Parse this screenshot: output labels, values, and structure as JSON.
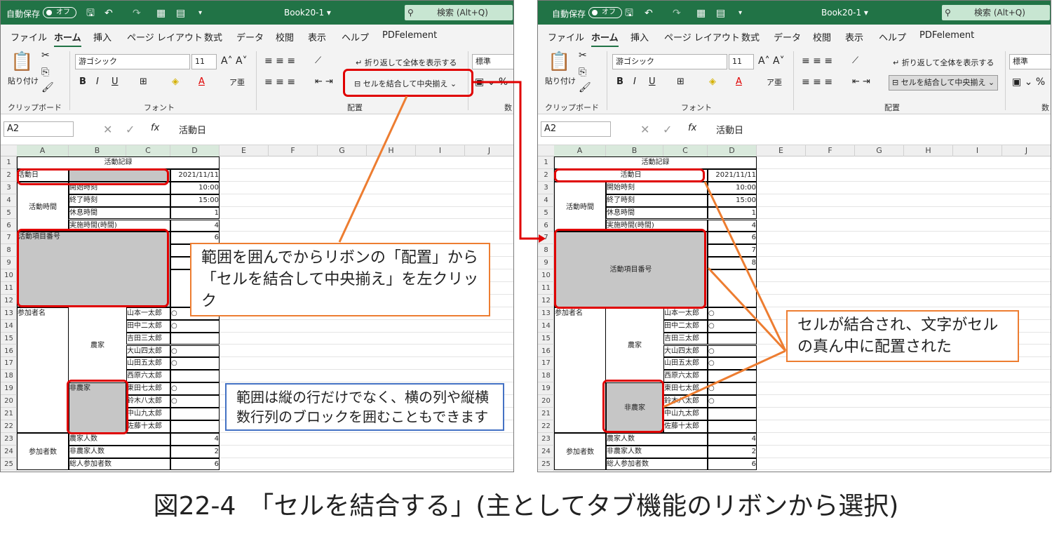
{
  "caption": "図22-4　「セルを結合する」(主としてタブ機能のリボンから選択)",
  "titlebar": {
    "autosave": "自動保存",
    "autosave_state": "オフ",
    "book": "Book20-1 ▾",
    "search": "検索 (Alt+Q)"
  },
  "menu": [
    "ファイル",
    "ホーム",
    "挿入",
    "ページ レイアウト",
    "数式",
    "データ",
    "校閲",
    "表示",
    "ヘルプ",
    "PDFelement"
  ],
  "ribbon": {
    "paste": "貼り付け",
    "clipboard_group": "クリップボード",
    "font_name": "游ゴシック",
    "font_size": "11",
    "font_group": "フォント",
    "wrap_text": "折り返して全体を表示する",
    "merge_center": "セルを結合して中央揃え",
    "align_group": "配置",
    "number_format": "標準",
    "number_group": "数",
    "bold": "B",
    "italic": "I",
    "underline": "U"
  },
  "formula": {
    "namebox": "A2",
    "fx": "fx",
    "content": "活動日"
  },
  "columns": [
    "A",
    "B",
    "C",
    "D",
    "E",
    "F",
    "G",
    "H",
    "I",
    "J"
  ],
  "rows": [
    "1",
    "2",
    "3",
    "4",
    "5",
    "6",
    "7",
    "8",
    "9",
    "10",
    "11",
    "12",
    "13",
    "14",
    "15",
    "16",
    "17",
    "18",
    "19",
    "20",
    "21",
    "22",
    "23",
    "24",
    "25"
  ],
  "cells": {
    "title": "活動記録",
    "date_label": "活動日",
    "date_value": "2021/11/11",
    "start": "開始時刻",
    "end": "終了時刻",
    "rest": "休息時間",
    "actual": "実施時間(時間)",
    "activity_time": "活動時間",
    "item_no": "活動項目番号",
    "participants": "参加者名",
    "farmer": "農家",
    "nonfarmer": "非農家",
    "people": [
      "山本一太郎",
      "田中二太郎",
      "吉田三太郎",
      "大山四太郎",
      "山田五太郎",
      "西原六太郎",
      "東田七太郎",
      "鈴木八太郎",
      "中山九太郎",
      "佐藤十太郎"
    ],
    "marks": [
      "○",
      "○",
      "",
      "○",
      "○",
      "",
      "○",
      "○",
      "",
      ""
    ],
    "farmer_count": "農家人数",
    "nonfarmer_count": "非農家人数",
    "total": "総人参加者数",
    "participant_count": "参加者数",
    "values": {
      "start": "10:00",
      "end": "15:00",
      "rest": "1",
      "actual": "4",
      "r7": "6",
      "r8": "7",
      "r9": "8",
      "farmer_n": "4",
      "nonfarmer_n": "2",
      "total_n": "6"
    }
  },
  "callouts": {
    "left_orange": "範囲を囲んでからリボンの「配置」から「セルを結合して中央揃え」を左クリック",
    "left_blue": "範囲は縦の行だけでなく、横の列や縦横数行列のブロックを囲むこともできます",
    "right_orange": "セルが結合され、文字がセルの真ん中に配置された"
  },
  "colors": {
    "excel_green": "#217346",
    "highlight": "#e00000",
    "callout_orange": "#ed7d31",
    "callout_blue": "#4472c4",
    "selection_gray": "#c6c6c6"
  }
}
